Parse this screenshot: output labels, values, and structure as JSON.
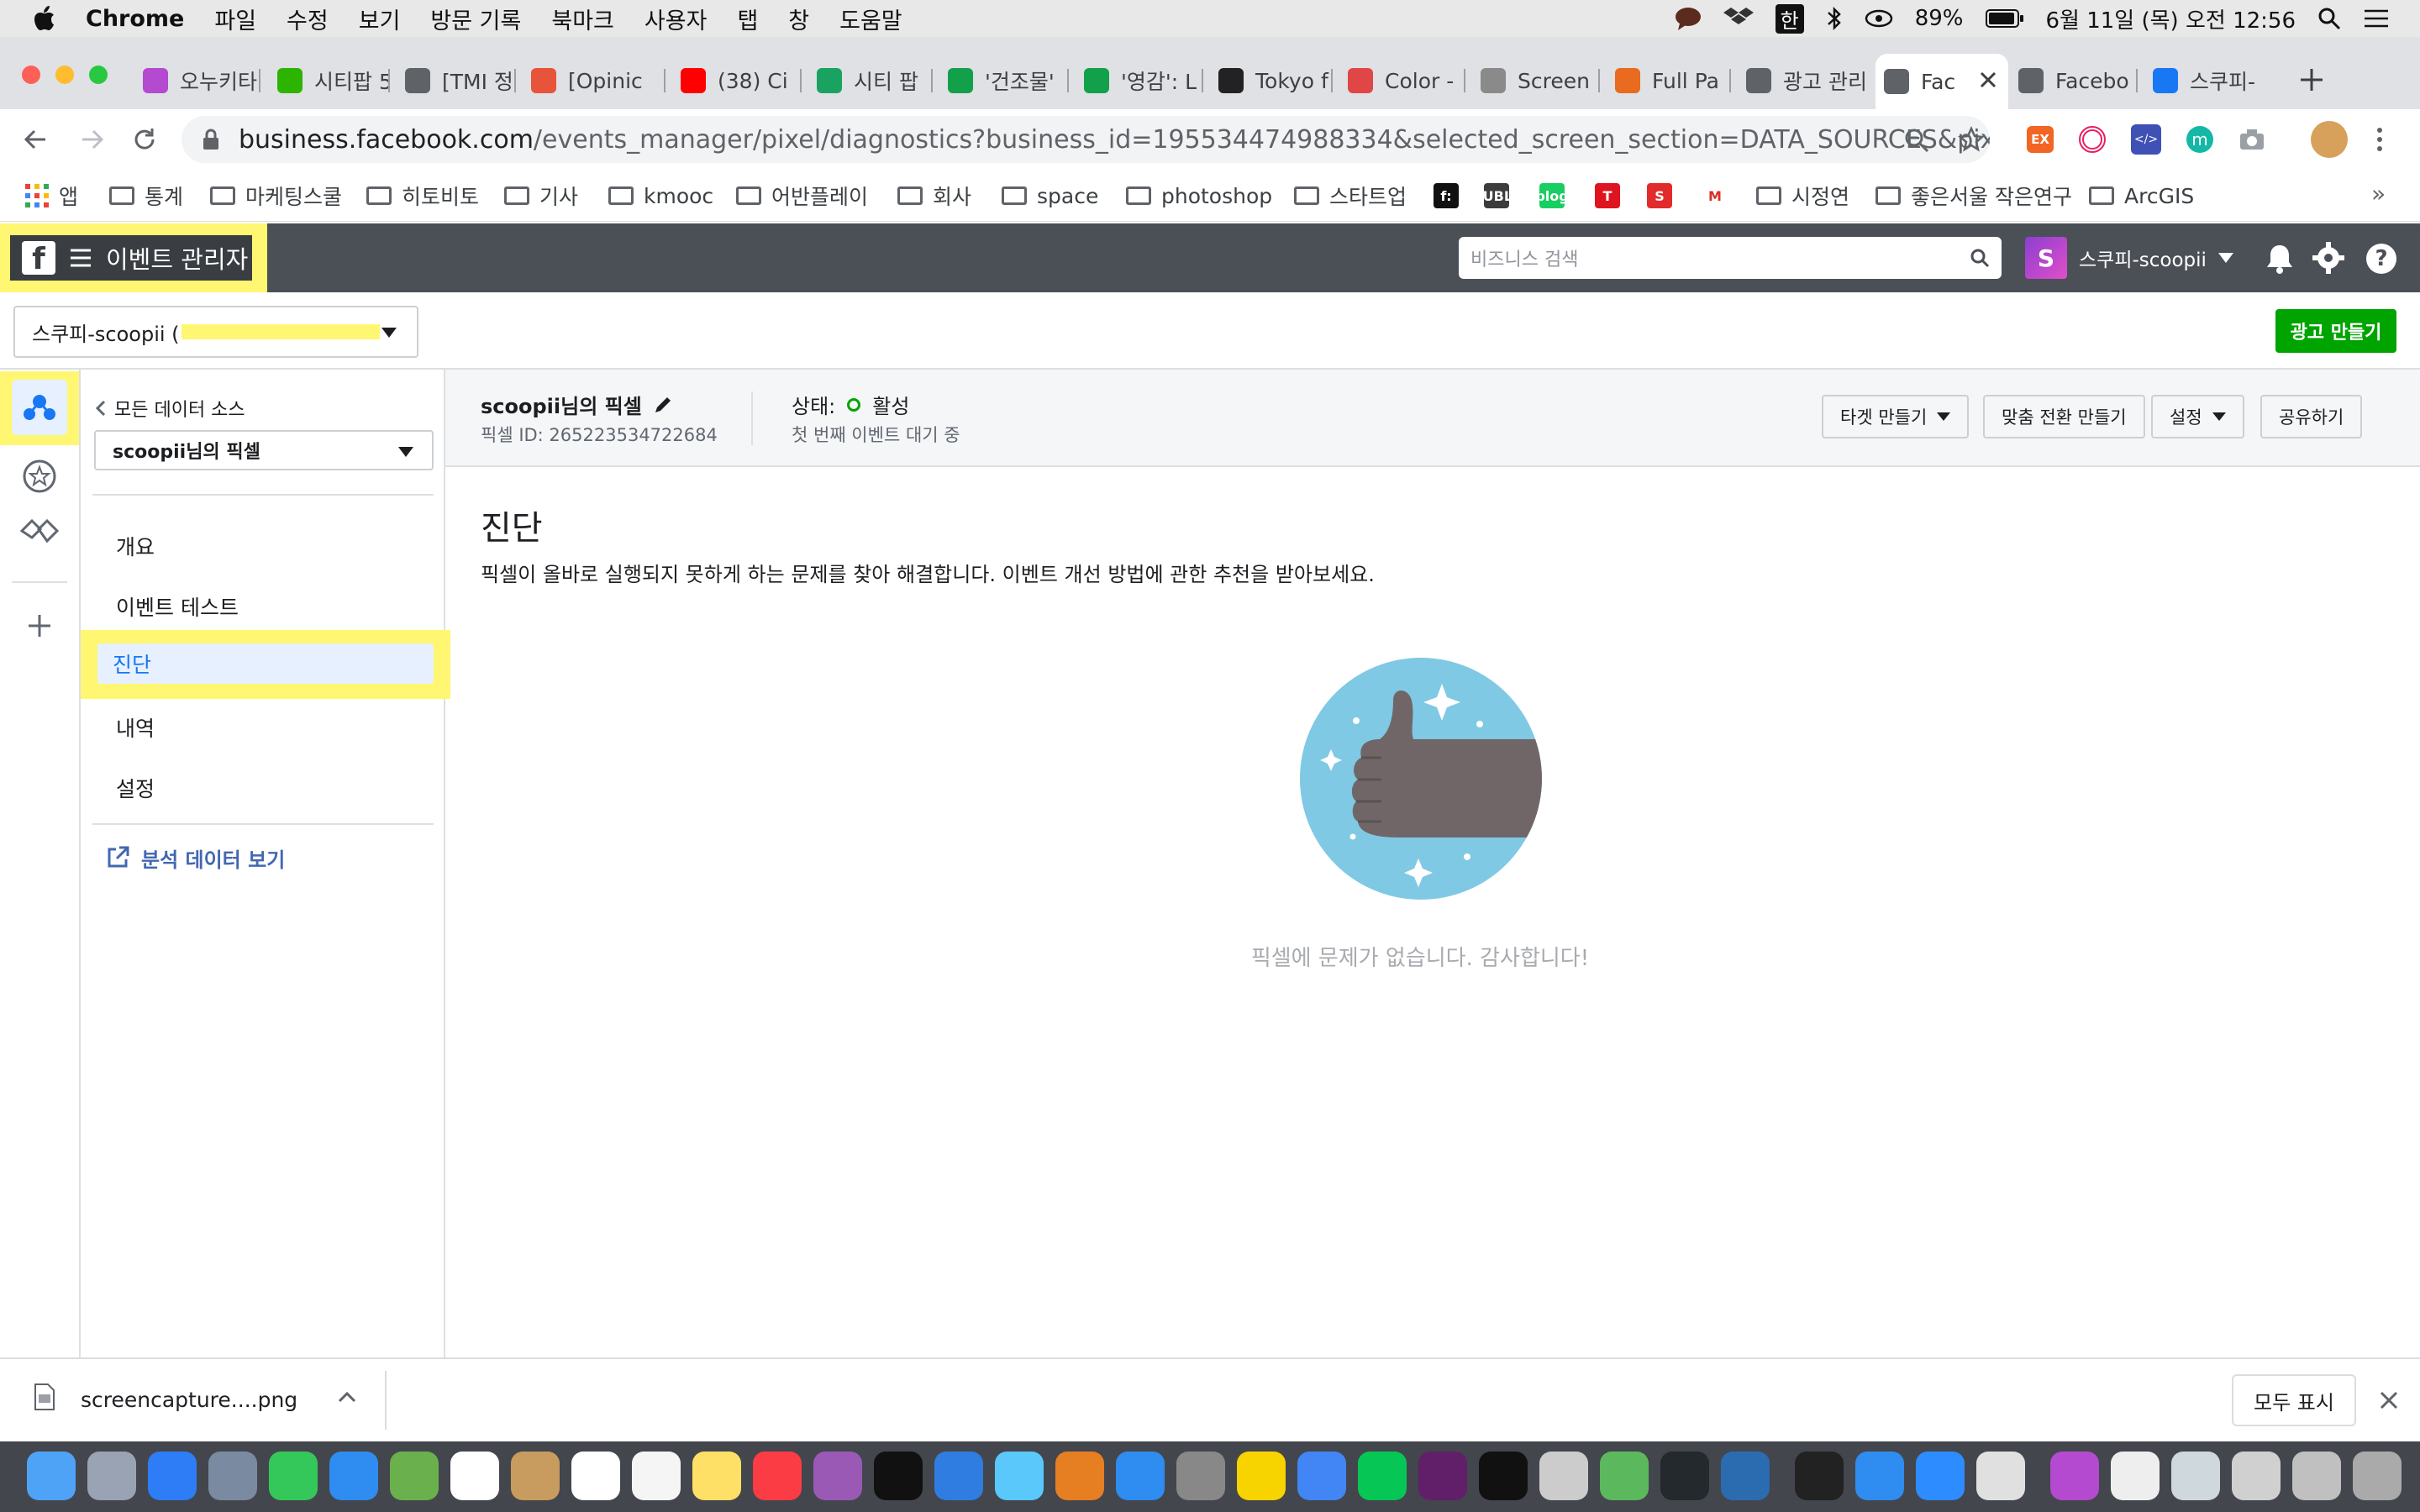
{
  "menubar": {
    "app": "Chrome",
    "items": [
      "파일",
      "수정",
      "보기",
      "방문 기록",
      "북마크",
      "사용자",
      "탭",
      "창",
      "도움말"
    ],
    "battery": "89%",
    "datetime": "6월 11일 (목) 오전 12:56",
    "input_source": "한"
  },
  "tabs": [
    {
      "label": "오누키타",
      "color": "#b44ad0"
    },
    {
      "label": "시티팝 5",
      "color": "#2db400"
    },
    {
      "label": "[TMI 정",
      "color": "#5f6368"
    },
    {
      "label": "[Opinic",
      "color": "#e8543a"
    },
    {
      "label": "(38) Ci",
      "color": "#ff0000"
    },
    {
      "label": "시티 팝",
      "color": "#1aa260"
    },
    {
      "label": "'건조물'",
      "color": "#13a04a"
    },
    {
      "label": "'영감': L",
      "color": "#13a04a"
    },
    {
      "label": "Tokyo f",
      "color": "#222222"
    },
    {
      "label": "Color -",
      "color": "#e04646"
    },
    {
      "label": "Screen",
      "color": "#8a8a8a"
    },
    {
      "label": "Full Pa",
      "color": "#e86b1f"
    },
    {
      "label": "광고 관리",
      "color": "#5f6368"
    },
    {
      "label": "Fac",
      "color": "#5f6368"
    },
    {
      "label": "Facebo",
      "color": "#5f6368"
    },
    {
      "label": "스쿠피-",
      "color": "#1877f2"
    }
  ],
  "address": {
    "host": "business.facebook.com",
    "path": "/events_manager/pixel/diagnostics?business_id=195534474988334&selected_screen_section=DATA_SOURCES&pixel_id=..."
  },
  "bookmarks": {
    "apps": "앱",
    "items": [
      "통계",
      "마케팅스쿨",
      "히토비토",
      "기사",
      "kmooc",
      "어반플레이",
      "회사",
      "space",
      "photoshop",
      "스타트업"
    ],
    "items2": [
      "시정연",
      "좋은서울 작은연구",
      "ArcGIS"
    ],
    "badges": [
      "f:",
      "PUBLY",
      "blog",
      "T",
      "S",
      "M"
    ]
  },
  "fb": {
    "brand_label": "이벤트 관리자",
    "search_placeholder": "비즈니스 검색",
    "account_name": "스쿠피-scoopii",
    "account_select": "스쿠피-scoopii (",
    "create_ad": "광고 만들기"
  },
  "sidenav": {
    "back": "모든 데이터 소스",
    "pixel_select": "scoopii님의 픽셀",
    "items": [
      "개요",
      "이벤트 테스트",
      "진단",
      "내역",
      "설정"
    ],
    "analytics": "분석 데이터 보기"
  },
  "pixel": {
    "name": "scoopii님의 픽셀",
    "id_label": "픽셀 ID: 265223534722684",
    "status_label": "상태:",
    "status_value": "활성",
    "status_sub": "첫 번째 이벤트 대기 중",
    "buttons": [
      "타겟 만들기",
      "맞춤 전환 만들기",
      "설정",
      "공유하기"
    ]
  },
  "diagnostics": {
    "title": "진단",
    "description": "픽셀이 올바로 실행되지 못하게 하는 문제를 찾아 해결합니다. 이벤트 개선 방법에 관한 추천을 받아보세요.",
    "empty_message": "픽셀에 문제가 없습니다. 감사합니다!"
  },
  "downloads": {
    "file": "screencapture....png",
    "show_all": "모두 표시"
  },
  "colors": {
    "highlight": "#fff672",
    "fb_header": "#4b4f56",
    "green": "#00a400",
    "link": "#4267b2",
    "active_nav_bg": "#e7f0ff"
  }
}
